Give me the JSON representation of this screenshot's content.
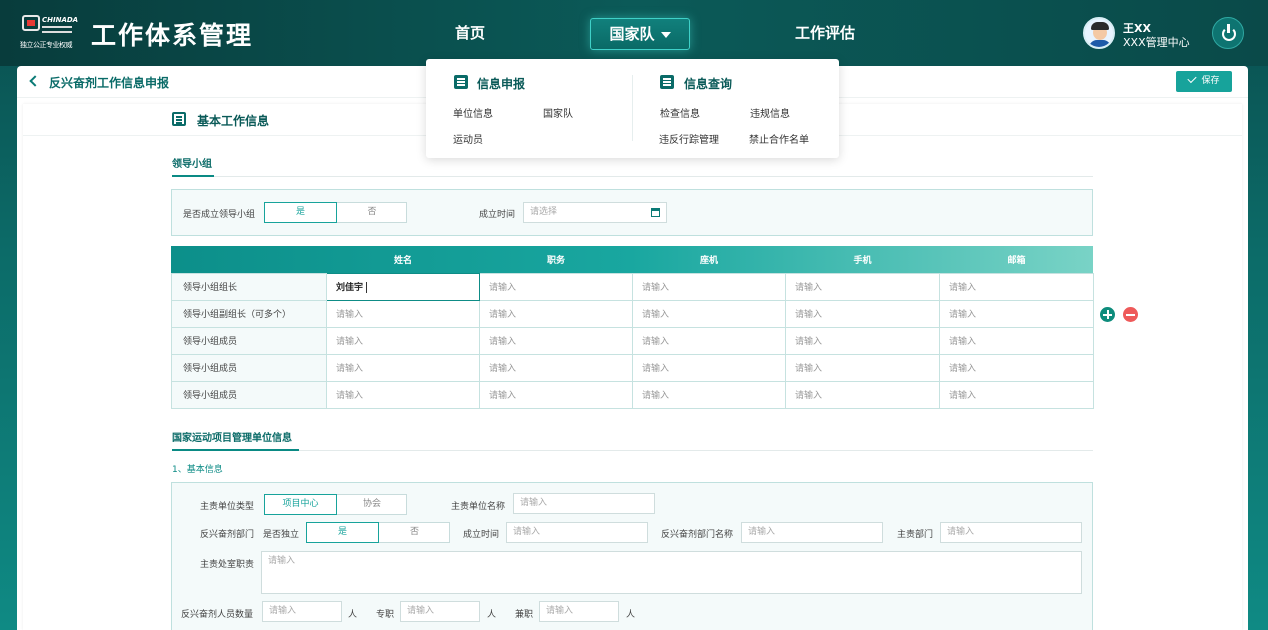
{
  "app": {
    "logo_brand": "CHINADA",
    "logo_sub": "独立公正专业权威",
    "title": "工作体系管理"
  },
  "nav": {
    "home": "首页",
    "team": "国家队",
    "eval": "工作评估"
  },
  "user": {
    "name": "王XX",
    "org": "XXX管理中心"
  },
  "dropdown": {
    "group1": {
      "title": "信息申报",
      "items": [
        "单位信息",
        "国家队",
        "运动员"
      ]
    },
    "group2": {
      "title": "信息查询",
      "items": [
        "检查信息",
        "违规信息",
        "违反行踪管理",
        "禁止合作名单"
      ]
    }
  },
  "page": {
    "title": "反兴奋剂工作信息申报",
    "save_label": "保存",
    "section_title": "基本工作信息"
  },
  "leadership": {
    "tab": "领导小组",
    "established_label": "是否成立领导小组",
    "yes": "是",
    "no": "否",
    "date_label": "成立时间",
    "date_placeholder": "请选择",
    "columns": [
      "姓名",
      "职务",
      "座机",
      "手机",
      "邮箱"
    ],
    "placeholder": "请输入",
    "rows": [
      {
        "label": "领导小组组长",
        "cells": [
          "刘佳宇",
          "请输入",
          "请输入",
          "请输入",
          "请输入"
        ]
      },
      {
        "label": "领导小组副组长（可多个）",
        "cells": [
          "请输入",
          "请输入",
          "请输入",
          "请输入",
          "请输入"
        ]
      },
      {
        "label": "领导小组成员",
        "cells": [
          "请输入",
          "请输入",
          "请输入",
          "请输入",
          "请输入"
        ]
      },
      {
        "label": "领导小组成员",
        "cells": [
          "请输入",
          "请输入",
          "请输入",
          "请输入",
          "请输入"
        ]
      },
      {
        "label": "领导小组成员",
        "cells": [
          "请输入",
          "请输入",
          "请输入",
          "请输入",
          "请输入"
        ]
      }
    ]
  },
  "unit": {
    "tab": "国家运动项目管理单位信息",
    "subsection": "1、基本信息",
    "type_label": "主责单位类型",
    "type_opt1": "项目中心",
    "type_opt2": "协会",
    "name_label": "主责单位名称",
    "dept_label": "反兴奋剂部门",
    "independent_label": "是否独立",
    "yes": "是",
    "no": "否",
    "date_label": "成立时间",
    "dept_name_label": "反兴奋剂部门名称",
    "main_dept_label": "主责部门",
    "duty_label": "主责处室职责",
    "staff_label": "反兴奋剂人员数量",
    "unit_person": "人",
    "fulltime_label": "专职",
    "parttime_label": "兼职",
    "placeholder": "请输入"
  },
  "colors": {
    "accent": "#17a39b",
    "nav_bg": "#0b5a58",
    "remove": "#ee5a5a"
  }
}
